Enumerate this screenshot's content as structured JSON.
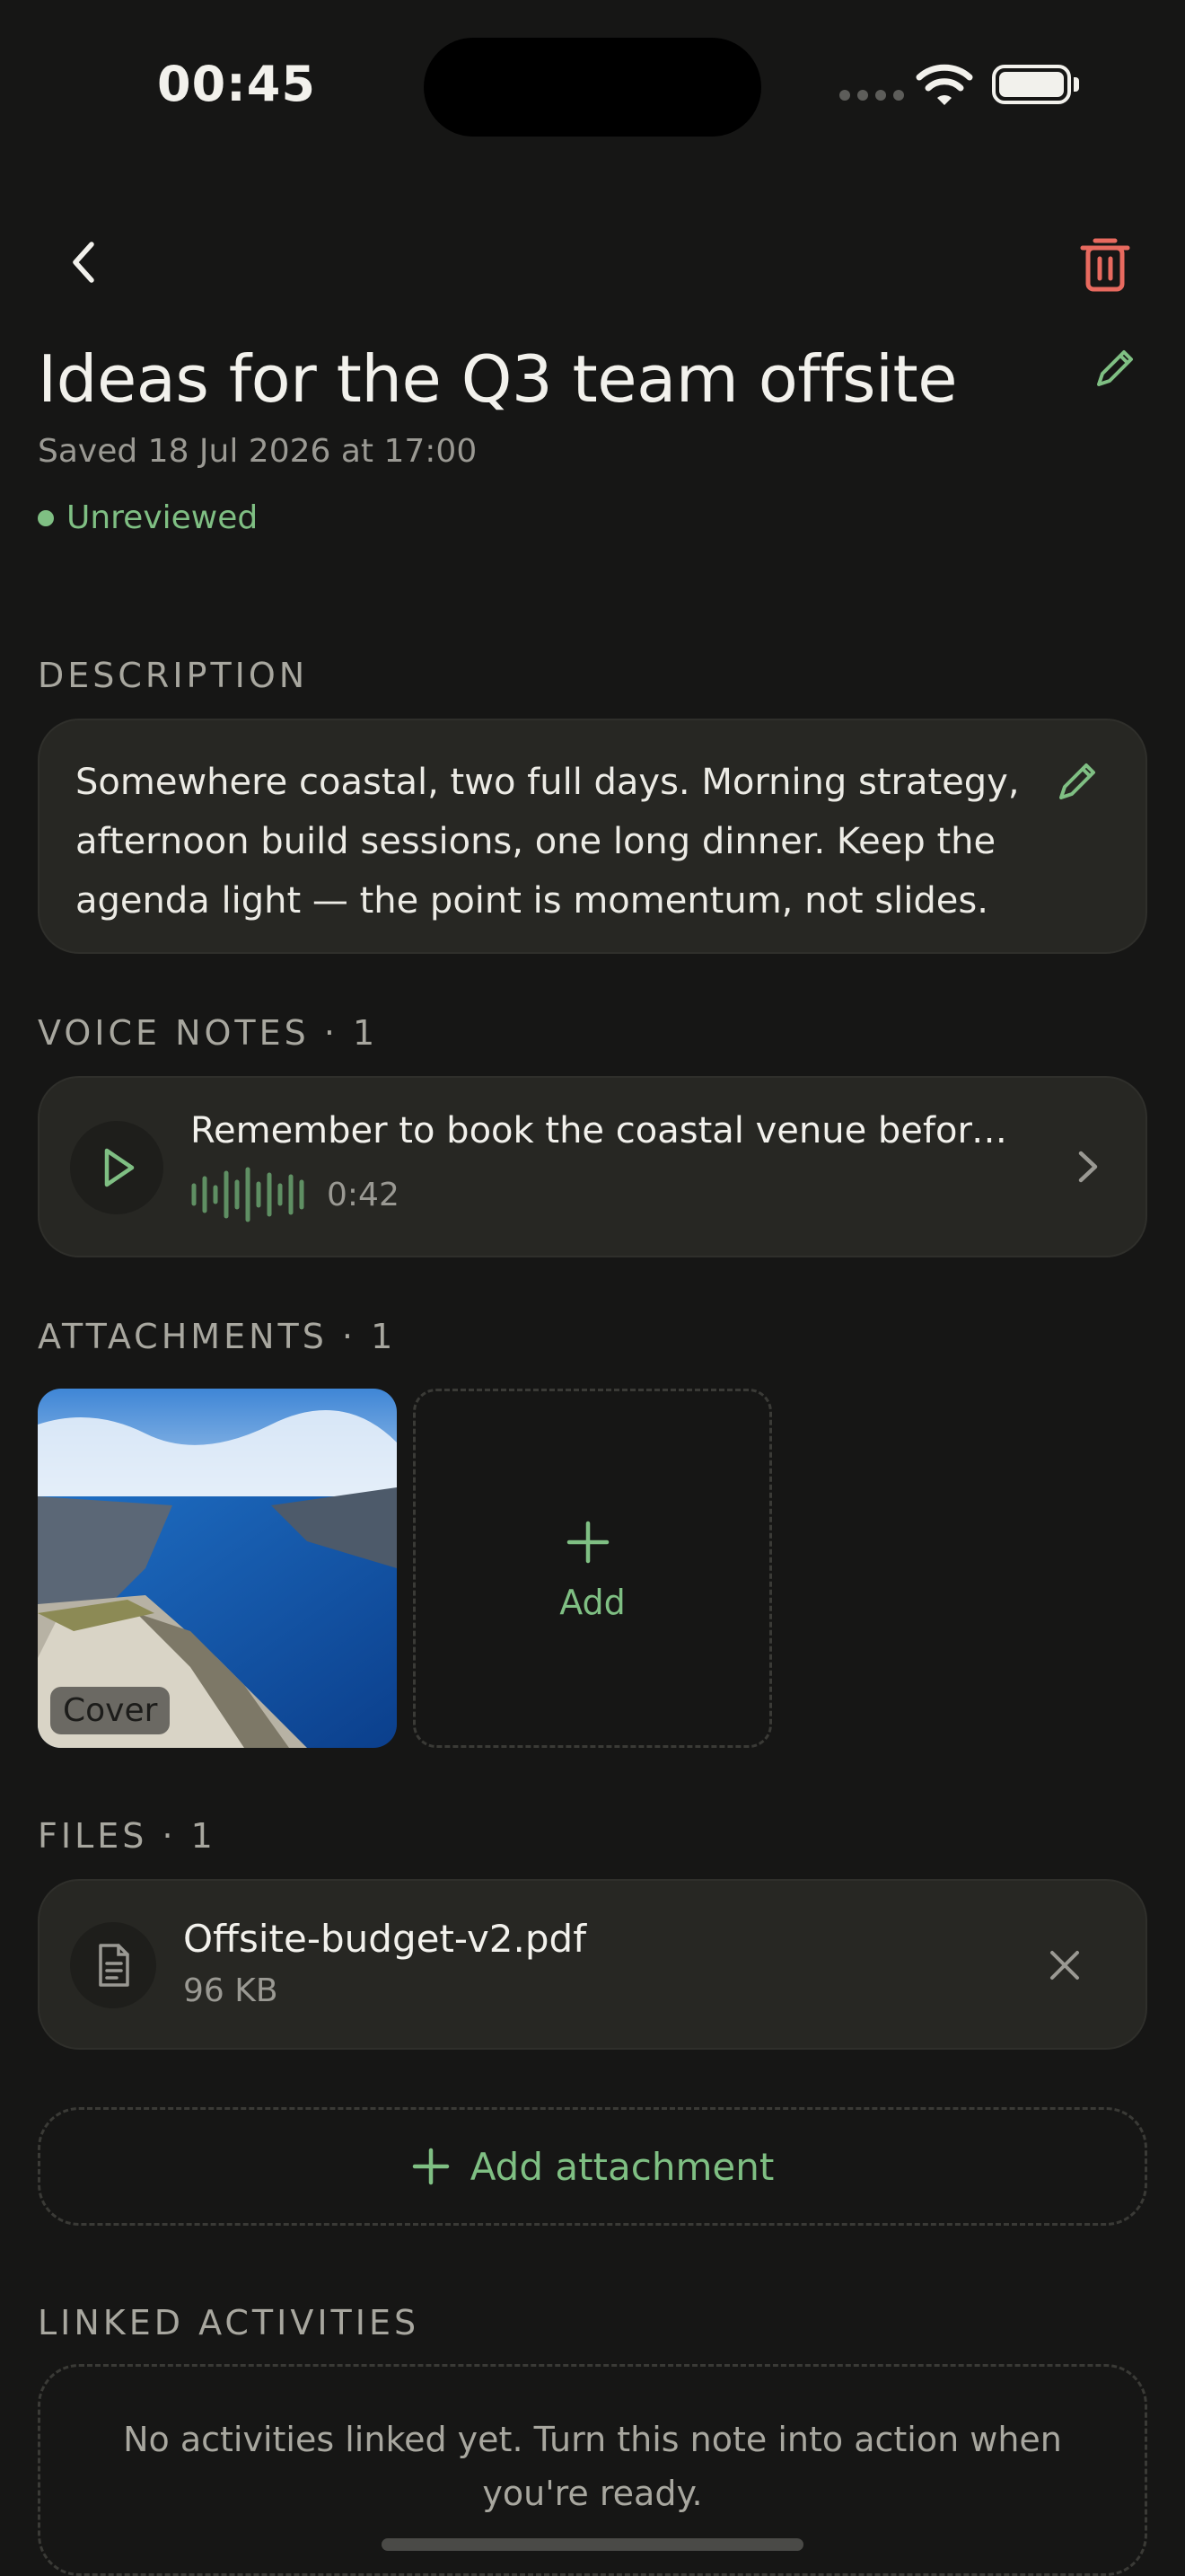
{
  "status_bar": {
    "time": "00:45"
  },
  "header": {
    "title": "Ideas for the Q3 team offsite",
    "saved": "Saved 18 Jul 2026 at 17:00",
    "status": "Unreviewed"
  },
  "description": {
    "label": "DESCRIPTION",
    "text": "Somewhere coastal, two full days. Morning strategy, afternoon build sessions, one long dinner. Keep the agenda light — the point is momentum, not slides."
  },
  "voice_notes": {
    "label": "VOICE NOTES · 1",
    "items": [
      {
        "title": "Remember to book the coastal venue before…",
        "duration": "0:42"
      }
    ]
  },
  "attachments": {
    "label": "ATTACHMENTS · 1",
    "cover_badge": "Cover",
    "add_label": "Add"
  },
  "files": {
    "label": "FILES · 1",
    "items": [
      {
        "name": "Offsite-budget-v2.pdf",
        "size": "96 KB"
      }
    ]
  },
  "add_attachment_label": "Add attachment",
  "linked_activities": {
    "label": "LINKED ACTIVITIES",
    "empty_text": "No activities linked yet. Turn this note into action when you're ready."
  },
  "colors": {
    "background": "#161615",
    "accent": "#7fbf83",
    "danger": "#e86a5f",
    "card": "#272723"
  },
  "icons": [
    "chevron-left-icon",
    "trash-icon",
    "pencil-icon",
    "play-icon",
    "waveform-icon",
    "chevron-right-icon",
    "plus-icon",
    "document-icon",
    "close-icon",
    "wifi-icon",
    "battery-icon"
  ]
}
